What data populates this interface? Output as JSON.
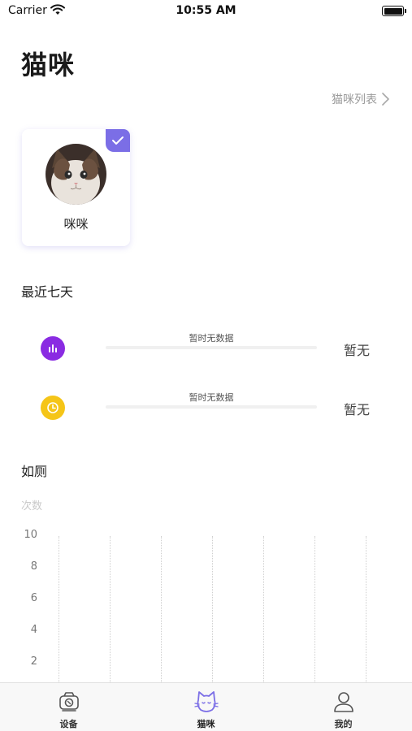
{
  "status_bar": {
    "carrier": "Carrier",
    "time": "10:55 AM"
  },
  "header": {
    "title": "猫咪",
    "cat_list_link": "猫咪列表"
  },
  "cats": [
    {
      "name": "咪咪",
      "selected": true
    }
  ],
  "recent": {
    "title": "最近七天",
    "rows": [
      {
        "icon": "bar-chart-icon",
        "color": "#8a2be2",
        "nodata_text": "暂时无数据",
        "value": "暂无"
      },
      {
        "icon": "clock-icon",
        "color": "#f5c518",
        "nodata_text": "暂时无数据",
        "value": "暂无"
      }
    ]
  },
  "toilet_chart": {
    "title": "如厕",
    "unit_label": "次数",
    "y_ticks": [
      "10",
      "8",
      "6",
      "4",
      "2"
    ]
  },
  "tab_bar": {
    "tabs": [
      {
        "label": "设备",
        "icon": "device-icon",
        "active": false
      },
      {
        "label": "猫咪",
        "icon": "cat-icon",
        "active": true
      },
      {
        "label": "我的",
        "icon": "user-icon",
        "active": false
      }
    ]
  },
  "colors": {
    "accent": "#7b6ee6",
    "purple_icon": "#8a2be2",
    "yellow_icon": "#f5c518"
  }
}
